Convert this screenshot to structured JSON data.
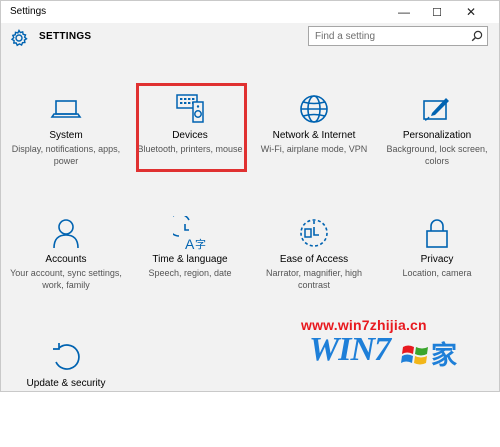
{
  "window": {
    "title": "Settings",
    "controls": {
      "minimize": "—",
      "maximize": "☐",
      "close": "✕"
    }
  },
  "header": {
    "heading": "SETTINGS",
    "search_placeholder": "Find a setting"
  },
  "tiles": [
    {
      "name": "System",
      "desc": "Display, notifications, apps, power",
      "icon": "laptop-icon"
    },
    {
      "name": "Devices",
      "desc": "Bluetooth, printers, mouse",
      "icon": "devices-icon",
      "selected": true
    },
    {
      "name": "Network & Internet",
      "desc": "Wi-Fi, airplane mode, VPN",
      "icon": "globe-icon"
    },
    {
      "name": "Personalization",
      "desc": "Background, lock screen, colors",
      "icon": "paint-icon"
    },
    {
      "name": "Accounts",
      "desc": "Your account, sync settings, work, family",
      "icon": "person-icon"
    },
    {
      "name": "Time & language",
      "desc": "Speech, region, date",
      "icon": "time-language-icon"
    },
    {
      "name": "Ease of Access",
      "desc": "Narrator, magnifier, high contrast",
      "icon": "ease-of-access-icon"
    },
    {
      "name": "Privacy",
      "desc": "Location, camera",
      "icon": "lock-icon"
    },
    {
      "name": "Update & security",
      "desc": "",
      "icon": "refresh-icon"
    }
  ],
  "watermark": {
    "url": "www.win7zhijia.cn",
    "logo_text": "WIN7",
    "logo_cn": "家"
  },
  "colors": {
    "accent": "#0063b1",
    "highlight": "#e03131",
    "watermark_red": "#e8191f",
    "watermark_blue": "#1e7fd8"
  }
}
